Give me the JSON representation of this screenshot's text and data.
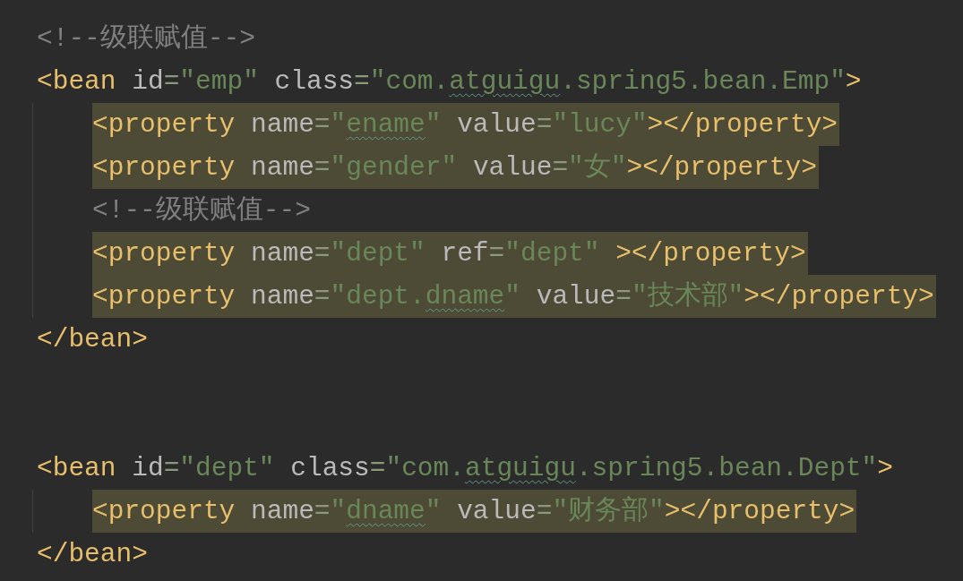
{
  "editor": {
    "lines": [
      {
        "kind": "code",
        "highlighted": false,
        "tokens": [
          {
            "kind": "comment",
            "text": "<!--级联赋值-->"
          }
        ]
      },
      {
        "kind": "code",
        "highlighted": false,
        "tokens": [
          {
            "kind": "tag",
            "text": "<bean "
          },
          {
            "kind": "attr",
            "text": "id"
          },
          {
            "kind": "eq",
            "text": "="
          },
          {
            "kind": "str",
            "text": "\"emp\" "
          },
          {
            "kind": "attr",
            "text": "class"
          },
          {
            "kind": "eq",
            "text": "="
          },
          {
            "kind": "str",
            "text": "\"com."
          },
          {
            "kind": "typo",
            "text": "atguigu"
          },
          {
            "kind": "str",
            "text": ".spring5.bean.Emp\""
          },
          {
            "kind": "tag",
            "text": ">"
          }
        ],
        "children": [
          {
            "kind": "code",
            "highlighted": true,
            "tokens": [
              {
                "kind": "tag",
                "text": "<property "
              },
              {
                "kind": "attr",
                "text": "name"
              },
              {
                "kind": "eq",
                "text": "="
              },
              {
                "kind": "str",
                "text": "\""
              },
              {
                "kind": "typo",
                "text": "ename"
              },
              {
                "kind": "str",
                "text": "\" "
              },
              {
                "kind": "attr",
                "text": "value"
              },
              {
                "kind": "eq",
                "text": "="
              },
              {
                "kind": "str",
                "text": "\"lucy\""
              },
              {
                "kind": "tag",
                "text": "></property>"
              }
            ]
          },
          {
            "kind": "code",
            "highlighted": true,
            "tokens": [
              {
                "kind": "tag",
                "text": "<property "
              },
              {
                "kind": "attr",
                "text": "name"
              },
              {
                "kind": "eq",
                "text": "="
              },
              {
                "kind": "str",
                "text": "\"gender\" "
              },
              {
                "kind": "attr",
                "text": "value"
              },
              {
                "kind": "eq",
                "text": "="
              },
              {
                "kind": "str",
                "text": "\"女\""
              },
              {
                "kind": "tag",
                "text": "></property>"
              }
            ]
          },
          {
            "kind": "code",
            "highlighted": false,
            "tokens": [
              {
                "kind": "comment",
                "text": "<!--级联赋值-->"
              }
            ]
          },
          {
            "kind": "code",
            "highlighted": true,
            "tokens": [
              {
                "kind": "tag",
                "text": "<property "
              },
              {
                "kind": "attr",
                "text": "name"
              },
              {
                "kind": "eq",
                "text": "="
              },
              {
                "kind": "str",
                "text": "\"dept\" "
              },
              {
                "kind": "attr",
                "text": "ref"
              },
              {
                "kind": "eq",
                "text": "="
              },
              {
                "kind": "str",
                "text": "\"dept\" "
              },
              {
                "kind": "tag",
                "text": "></property>"
              }
            ]
          },
          {
            "kind": "code",
            "highlighted": true,
            "tokens": [
              {
                "kind": "tag",
                "text": "<property "
              },
              {
                "kind": "attr",
                "text": "name"
              },
              {
                "kind": "eq",
                "text": "="
              },
              {
                "kind": "str",
                "text": "\"dept."
              },
              {
                "kind": "typo",
                "text": "dname"
              },
              {
                "kind": "str",
                "text": "\" "
              },
              {
                "kind": "attr",
                "text": "value"
              },
              {
                "kind": "eq",
                "text": "="
              },
              {
                "kind": "str",
                "text": "\"技术部\""
              },
              {
                "kind": "tag",
                "text": "></property>"
              }
            ]
          }
        ]
      },
      {
        "kind": "code",
        "highlighted": false,
        "tokens": [
          {
            "kind": "tag",
            "text": "</bean>"
          }
        ]
      },
      {
        "kind": "blank"
      },
      {
        "kind": "blank"
      },
      {
        "kind": "code",
        "highlighted": false,
        "tokens": [
          {
            "kind": "tag",
            "text": "<bean "
          },
          {
            "kind": "attr",
            "text": "id"
          },
          {
            "kind": "eq",
            "text": "="
          },
          {
            "kind": "str",
            "text": "\"dept\" "
          },
          {
            "kind": "attr",
            "text": "class"
          },
          {
            "kind": "eq",
            "text": "="
          },
          {
            "kind": "str",
            "text": "\"com."
          },
          {
            "kind": "typo",
            "text": "atguigu"
          },
          {
            "kind": "str",
            "text": ".spring5.bean.Dept\""
          },
          {
            "kind": "tag",
            "text": ">"
          }
        ],
        "children": [
          {
            "kind": "code",
            "highlighted": true,
            "tokens": [
              {
                "kind": "tag",
                "text": "<property "
              },
              {
                "kind": "attr",
                "text": "name"
              },
              {
                "kind": "eq",
                "text": "="
              },
              {
                "kind": "str",
                "text": "\""
              },
              {
                "kind": "typo",
                "text": "dname"
              },
              {
                "kind": "str",
                "text": "\" "
              },
              {
                "kind": "attr",
                "text": "value"
              },
              {
                "kind": "eq",
                "text": "="
              },
              {
                "kind": "str",
                "text": "\"财务部\""
              },
              {
                "kind": "tag",
                "text": "></property>"
              }
            ]
          }
        ]
      },
      {
        "kind": "code",
        "highlighted": false,
        "tokens": [
          {
            "kind": "tag",
            "text": "</bean>"
          }
        ]
      }
    ]
  }
}
